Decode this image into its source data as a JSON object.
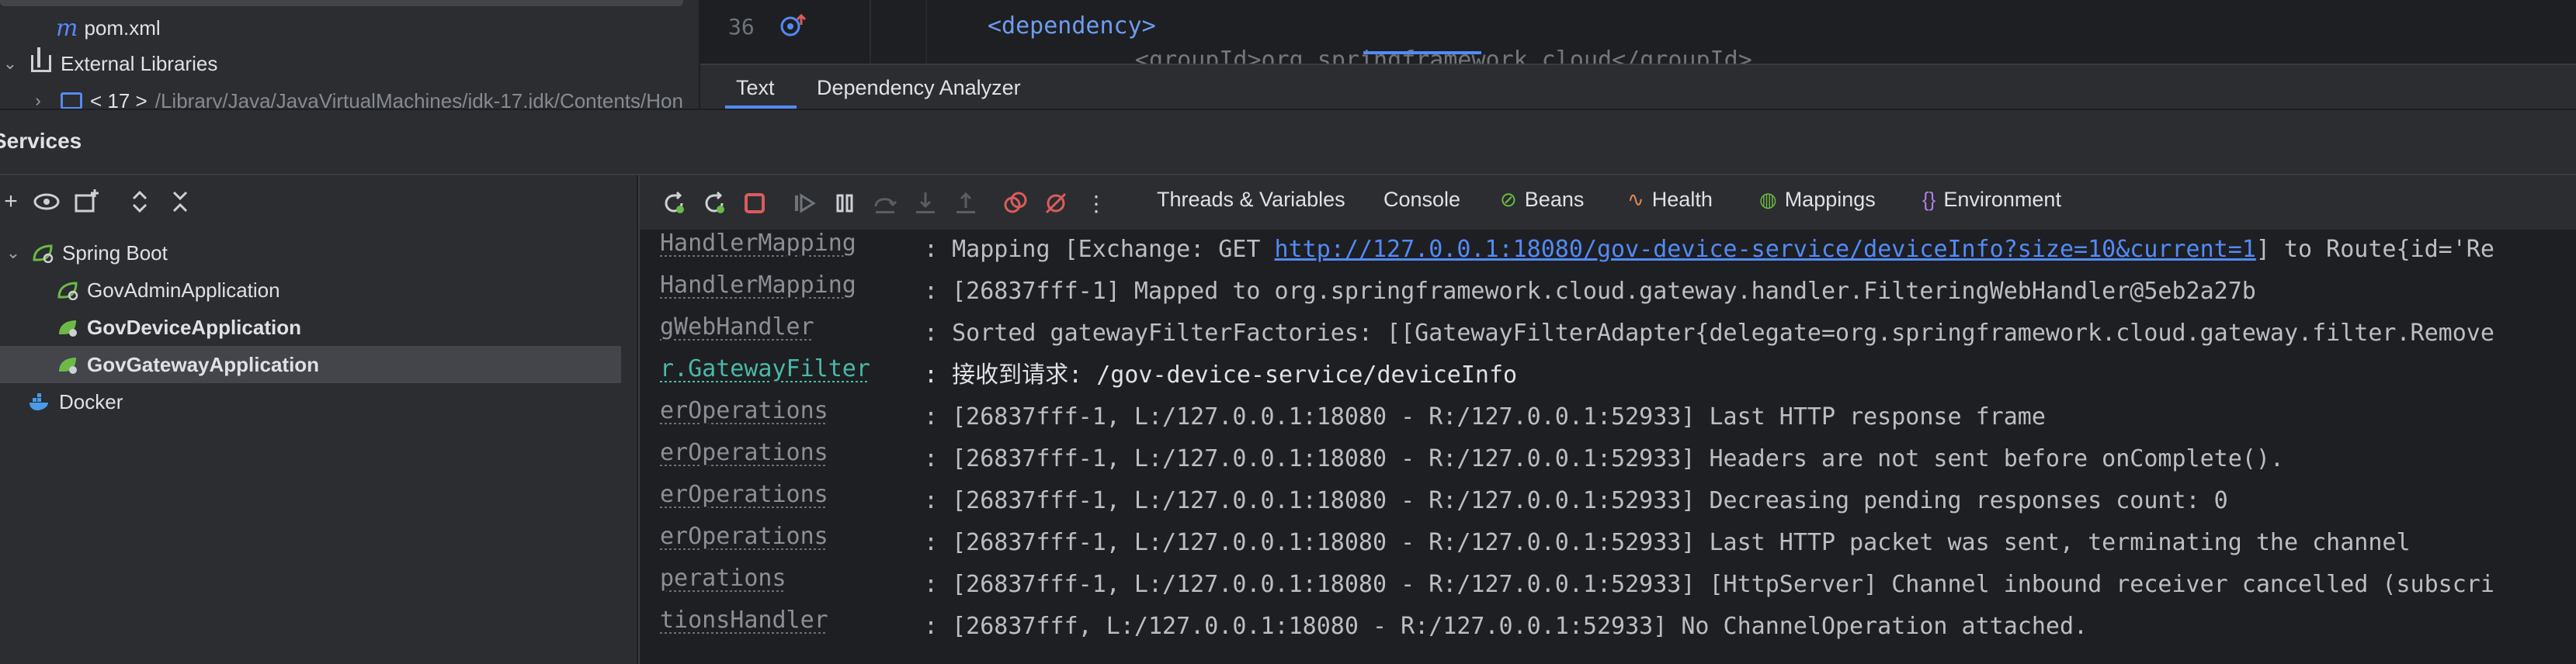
{
  "project_tree": {
    "items": [
      {
        "label": "pom.xml",
        "icon": "maven-icon"
      },
      {
        "label": "External Libraries",
        "icon": "library-icon"
      },
      {
        "label": "< 17 >",
        "suffix": "/Library/Java/JavaVirtualMachines/jdk-17.jdk/Contents/Hon",
        "icon": "folder-icon"
      }
    ]
  },
  "editor": {
    "line_number": "36",
    "code": "<dependency>",
    "partial_code": "<groupId>org.springframework.cloud</groupId>",
    "tabs": [
      {
        "label": "Text",
        "active": true
      },
      {
        "label": "Dependency Analyzer",
        "active": false
      }
    ]
  },
  "services": {
    "title": "Services",
    "tree": [
      {
        "label": "Spring Boot",
        "level": 0,
        "expanded": true,
        "bold": false
      },
      {
        "label": "GovAdminApplication",
        "level": 1,
        "bold": false
      },
      {
        "label": "GovDeviceApplication",
        "level": 1,
        "bold": true
      },
      {
        "label": "GovGatewayApplication",
        "level": 1,
        "bold": true,
        "selected": true
      },
      {
        "label": "Docker",
        "level": 0,
        "bold": false
      }
    ]
  },
  "console_tabs": [
    {
      "label": "Threads & Variables",
      "icon": ""
    },
    {
      "label": "Console",
      "icon": "",
      "active": true
    },
    {
      "label": "Beans",
      "icon": "beans-icon"
    },
    {
      "label": "Health",
      "icon": "health-icon"
    },
    {
      "label": "Mappings",
      "icon": "mappings-icon"
    },
    {
      "label": "Environment",
      "icon": "environment-icon"
    }
  ],
  "log": [
    {
      "source": "HandlerMapping",
      "msg_pre": ": Mapping [Exchange: GET ",
      "link": "http://127.0.0.1:18080/gov-device-service/deviceInfo?size=10&current=1",
      "msg_post": "] to Route{id='Re"
    },
    {
      "source": "HandlerMapping",
      "msg_pre": ": [26837fff-1] Mapped to org.springframework.cloud.gateway.handler.FilteringWebHandler@5eb2a27b"
    },
    {
      "source": "gWebHandler",
      "msg_pre": ": Sorted gatewayFilterFactories: [[GatewayFilterAdapter{delegate=org.springframework.cloud.gateway.filter.Remove"
    },
    {
      "source": "r.GatewayFilter",
      "msg_pre": ": 接收到请求: /gov-device-service/deviceInfo",
      "highlight": true
    },
    {
      "source": "erOperations",
      "msg_pre": ": [26837fff-1, L:/127.0.0.1:18080 - R:/127.0.0.1:52933] Last HTTP response frame"
    },
    {
      "source": "erOperations",
      "msg_pre": ": [26837fff-1, L:/127.0.0.1:18080 - R:/127.0.0.1:52933] Headers are not sent before onComplete()."
    },
    {
      "source": "erOperations",
      "msg_pre": ": [26837fff-1, L:/127.0.0.1:18080 - R:/127.0.0.1:52933] Decreasing pending responses count: 0"
    },
    {
      "source": "erOperations",
      "msg_pre": ": [26837fff-1, L:/127.0.0.1:18080 - R:/127.0.0.1:52933] Last HTTP packet was sent, terminating the channel"
    },
    {
      "source": "perations",
      "msg_pre": ": [26837fff-1, L:/127.0.0.1:18080 - R:/127.0.0.1:52933] [HttpServer] Channel inbound receiver cancelled (subscri"
    },
    {
      "source": "tionsHandler",
      "msg_pre": ": [26837fff, L:/127.0.0.1:18080 - R:/127.0.0.1:52933] No ChannelOperation attached."
    }
  ],
  "colors": {
    "accent": "#548af7",
    "link": "#548af7",
    "spring_green": "#6cb947",
    "stop_red": "#db5c5c"
  }
}
